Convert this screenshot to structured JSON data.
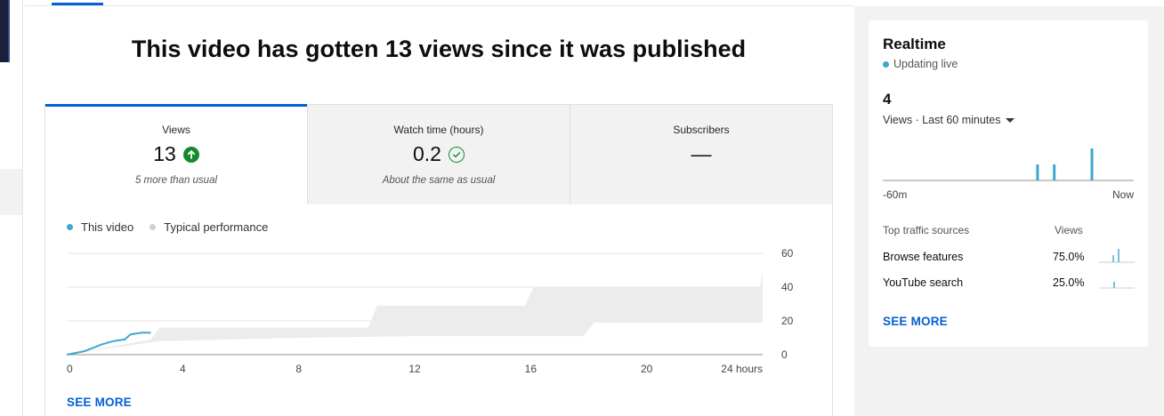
{
  "headline": "This video has gotten 13 views since it was published",
  "metrics": [
    {
      "label": "Views",
      "value": "13",
      "note": "5 more than usual",
      "indicator": "up-arrow"
    },
    {
      "label": "Watch time (hours)",
      "value": "0.2",
      "note": "About the same as usual",
      "indicator": "check"
    },
    {
      "label": "Subscribers",
      "value": "—",
      "note": "",
      "indicator": "none"
    }
  ],
  "legend": {
    "this_video": "This video",
    "typical": "Typical performance"
  },
  "see_more": "SEE MORE",
  "chart_data": {
    "type": "area",
    "x_label": "",
    "x_ticks": [
      "0",
      "4",
      "8",
      "12",
      "16",
      "20",
      "24 hours"
    ],
    "y_ticks": [
      "60",
      "40",
      "20",
      "0"
    ],
    "xlim": [
      0,
      24
    ],
    "ylim": [
      0,
      60
    ],
    "series": [
      {
        "name": "This video",
        "color": "#3ea6d0",
        "points": [
          [
            0,
            0
          ],
          [
            0.3,
            1
          ],
          [
            0.6,
            2
          ],
          [
            0.9,
            4
          ],
          [
            1.2,
            6
          ],
          [
            1.6,
            8
          ],
          [
            2.0,
            9
          ],
          [
            2.2,
            12
          ],
          [
            2.6,
            13
          ],
          [
            2.9,
            13
          ]
        ]
      },
      {
        "name": "Typical performance",
        "color": "#ececec",
        "upper": [
          [
            2.9,
            9
          ],
          [
            3.2,
            16
          ],
          [
            10.4,
            16
          ],
          [
            10.7,
            29
          ],
          [
            15.8,
            29
          ],
          [
            16.1,
            40
          ],
          [
            23.9,
            40
          ],
          [
            24,
            49
          ]
        ],
        "lower": [
          [
            0,
            0
          ],
          [
            3.2,
            8
          ],
          [
            8,
            10
          ],
          [
            12,
            11
          ],
          [
            17.8,
            11
          ],
          [
            18.2,
            19
          ],
          [
            24,
            19
          ]
        ]
      }
    ]
  },
  "realtime": {
    "title": "Realtime",
    "status": "Updating live",
    "count": "4",
    "range_label": "Views · Last 60 minutes",
    "axis_start": "-60m",
    "axis_end": "Now",
    "bars": [
      {
        "minute": -23,
        "views": 1
      },
      {
        "minute": -19,
        "views": 1
      },
      {
        "minute": -10,
        "views": 2
      }
    ],
    "header_sources": "Top traffic sources",
    "header_views": "Views",
    "sources": [
      {
        "name": "Browse features",
        "pct": "75.0%"
      },
      {
        "name": "YouTube search",
        "pct": "25.0%"
      }
    ],
    "see_more": "SEE MORE",
    "accent": "#3ea6d0"
  },
  "colors": {
    "brand_blue": "#065fd4",
    "up_green": "#138a2e",
    "line_blue": "#3ea6d0"
  }
}
